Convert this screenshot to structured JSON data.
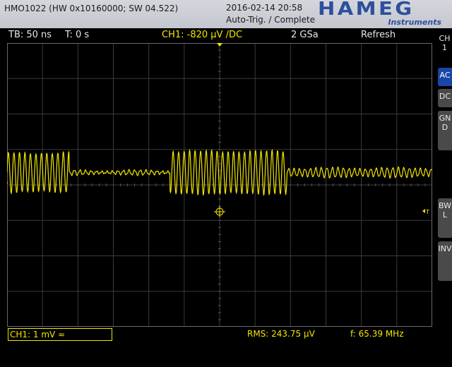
{
  "header": {
    "model": "HMO1022 (HW 0x10160000; SW 04.522)",
    "datetime": "2016-02-14 20:58",
    "trigger_status": "Auto-Trig. / Complete",
    "brand": "HAMEG",
    "brand_sub": "Instruments"
  },
  "status": {
    "timebase": "TB: 50 ns",
    "trigger_time": "T: 0 s",
    "channel_info": "CH1: -820 µV /DC",
    "sample_rate": "2 GSa",
    "acquisition": "Refresh"
  },
  "bottom": {
    "channel_scale": "CH1: 1 mV ≈",
    "rms": "RMS: 243.75 µV",
    "frequency": "f: 65.39 MHz"
  },
  "side": {
    "channel": "CH1",
    "buttons": [
      "AC",
      "DC",
      "GND",
      "BWL",
      "INV"
    ],
    "active": "AC"
  },
  "markers": {
    "trigger_level": "T"
  },
  "colors": {
    "trace": "#f2e600",
    "grid": "#3a3a3a",
    "active_button": "#1a47a6",
    "brand": "#2e4f9c"
  },
  "chart_data": {
    "type": "line",
    "x_divisions": 12,
    "y_divisions": 8,
    "series": [
      {
        "segments": [
          {
            "x0": 0.0,
            "x1": 1.75,
            "amp": 0.55,
            "period": 0.155
          },
          {
            "x0": 1.75,
            "x1": 4.6,
            "amp": 0.05,
            "period": 0.155
          },
          {
            "x0": 4.6,
            "x1": 7.9,
            "amp": 0.6,
            "period": 0.155
          },
          {
            "x0": 7.9,
            "x1": 12.0,
            "amp": 0.12,
            "period": 0.155
          }
        ],
        "offset_div": 0.35
      }
    ]
  }
}
